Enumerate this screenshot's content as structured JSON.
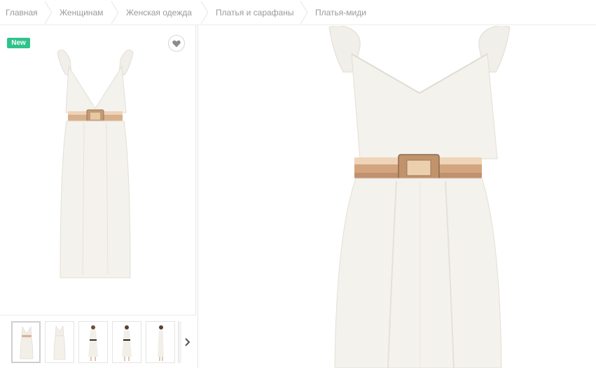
{
  "breadcrumbs": [
    {
      "label": "Главная"
    },
    {
      "label": "Женщинам"
    },
    {
      "label": "Женская одежда"
    },
    {
      "label": "Платья и сарафаны"
    },
    {
      "label": "Платья-миди"
    }
  ],
  "product": {
    "badge": "New",
    "favorite_icon": "heart-icon",
    "thumbnails_count": 5,
    "selected_thumbnail": 1
  },
  "colors": {
    "badge": "#2fc38c",
    "text_muted": "#9a9a9a",
    "border": "#e6e6e6",
    "dress": "#f4f2ec",
    "belt": "#d9b08c"
  }
}
